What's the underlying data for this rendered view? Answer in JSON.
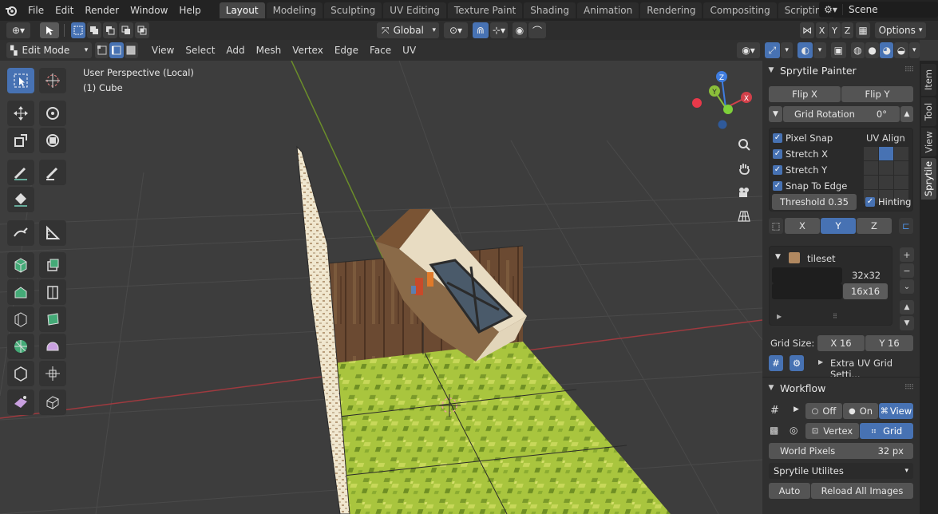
{
  "topbar": {
    "menus": [
      "File",
      "Edit",
      "Render",
      "Window",
      "Help"
    ],
    "workspaces": [
      "Layout",
      "Modeling",
      "Sculpting",
      "UV Editing",
      "Texture Paint",
      "Shading",
      "Animation",
      "Rendering",
      "Compositing",
      "Scripting"
    ],
    "active_workspace": "Layout",
    "add_tab": "+",
    "scene": "Scene"
  },
  "toolheader": {
    "orientation": "Global",
    "axes": [
      "X",
      "Y",
      "Z"
    ],
    "options": "Options"
  },
  "viewport_header": {
    "mode": "Edit Mode",
    "menus": [
      "View",
      "Select",
      "Add",
      "Mesh",
      "Vertex",
      "Edge",
      "Face",
      "UV"
    ]
  },
  "viewport": {
    "perspective": "User Perspective (Local)",
    "object": "(1) Cube",
    "gizmo": {
      "x": "X",
      "y": "Y",
      "z": "Z"
    }
  },
  "sidebar_tabs": [
    "Item",
    "Tool",
    "View",
    "Sprytile"
  ],
  "active_sidebar_tab": "Sprytile",
  "sprytile_painter": {
    "title": "Sprytile Painter",
    "flip_x": "Flip X",
    "flip_y": "Flip Y",
    "grid_rotation_label": "Grid Rotation",
    "grid_rotation_value": "0°",
    "pixel_snap": "Pixel Snap",
    "stretch_x": "Stretch X",
    "stretch_y": "Stretch Y",
    "snap_to_edge": "Snap To Edge",
    "uv_align": "UV Align",
    "threshold": "Threshold  0.35",
    "hinting": "Hinting",
    "axis_buttons": [
      "X",
      "Y",
      "Z"
    ],
    "active_axis": "Y",
    "tileset_name": "tileset",
    "grid_sizes": [
      "32x32",
      "16x16"
    ],
    "grid_size_label": "Grid Size:",
    "grid_size_x": "X    16",
    "grid_size_y": "Y    16",
    "extra_uv": "Extra UV Grid Setti..."
  },
  "workflow": {
    "title": "Workflow",
    "off": "Off",
    "on": "On",
    "view": "View",
    "vertex": "Vertex",
    "grid": "Grid",
    "world_pixels_label": "World Pixels",
    "world_pixels_value": "32 px",
    "utilities": "Sprytile Utilites",
    "auto": "Auto",
    "reload": "Reload All Images"
  },
  "colors": {
    "accent": "#4772b3",
    "grass": "#9fbf3a",
    "wood": "#6b4a32",
    "axis_x": "#d2404a",
    "axis_y": "#8bbf3a",
    "axis_z": "#3f7de0"
  }
}
